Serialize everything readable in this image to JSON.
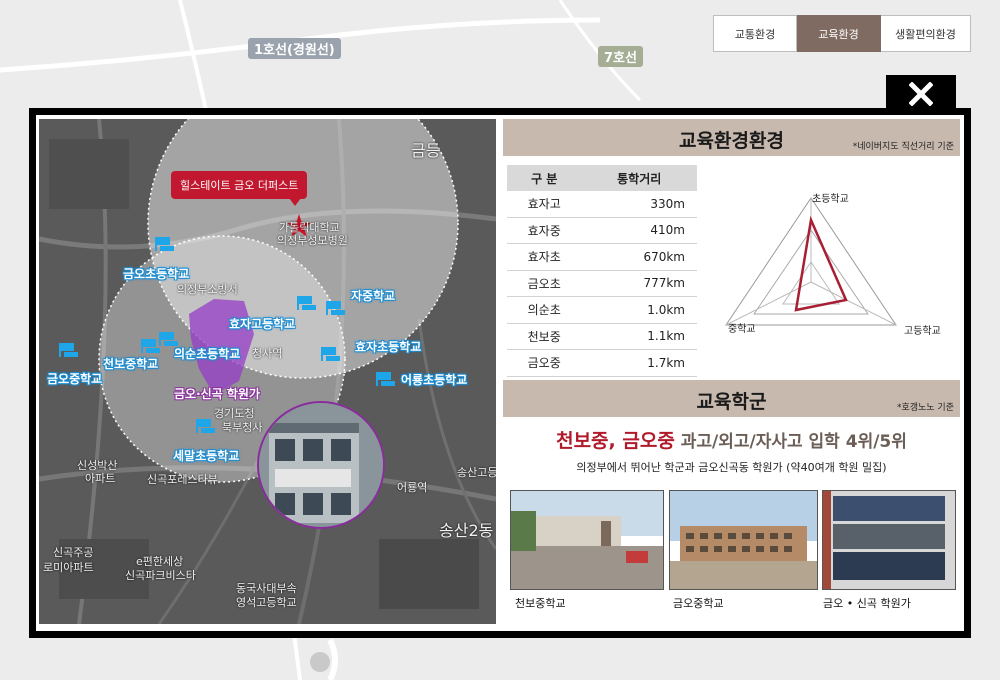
{
  "tabs": [
    {
      "label": "교통환경",
      "active": false
    },
    {
      "label": "교육환경",
      "active": true
    },
    {
      "label": "생활편의환경",
      "active": false
    }
  ],
  "background_map": {
    "labels": [
      "1호선(경원선)",
      "7호선"
    ]
  },
  "map": {
    "site_label": "힐스테이트 금오 더퍼스트",
    "area_label": "금오·신곡 학원가",
    "schools": [
      "금오초등학교",
      "자중학교",
      "효자고등학교",
      "의순초등학교",
      "천보중학교",
      "효자초등학교",
      "금오중학교",
      "어룡초등학교",
      "세말초등학교"
    ],
    "place_labels": [
      "가톨릭대학교",
      "의정부성모병원",
      "의정부소방서",
      "청사역",
      "경기도청",
      "북부청사",
      "신성박산",
      "아파트",
      "신곡포레스타뷰",
      "신곡주공",
      "로미아파트",
      "e편한세상",
      "신곡파크비스타",
      "동국사대부속",
      "영석고등학교",
      "금등",
      "송산2동",
      "어룡역",
      "송산고등"
    ]
  },
  "edu_env": {
    "title": "교육환경환경",
    "note": "*네이버지도 직선거리 기준",
    "table_headers": [
      "구 분",
      "통학거리"
    ],
    "rows": [
      {
        "name": "효자고",
        "dist": "330m"
      },
      {
        "name": "효자중",
        "dist": "410m"
      },
      {
        "name": "효자초",
        "dist": "670km"
      },
      {
        "name": "금오초",
        "dist": "777km"
      },
      {
        "name": "의순초",
        "dist": "1.0km"
      },
      {
        "name": "천보중",
        "dist": "1.1km"
      },
      {
        "name": "금오중",
        "dist": "1.7km"
      }
    ],
    "radar_labels": {
      "top": "초등학교",
      "left": "중학교",
      "right": "고등학교"
    }
  },
  "edu_zone": {
    "title": "교육학군",
    "note": "*호갱노노 기준",
    "headline_red": "천보중, 금오중",
    "headline_gray": " 과고/외고/자사고 입학 4위/5위",
    "subline": "의정부에서 뛰어난 학군과 금오신곡동 학원가 (약40여개 학원 밀집)",
    "photos": [
      {
        "caption": "천보중학교"
      },
      {
        "caption": "금오중학교"
      },
      {
        "caption": "금오 • 신곡 학원가"
      }
    ]
  },
  "colors": {
    "accent_tab": "#7f6b62",
    "head_bg": "#c8b9ae",
    "radar_line": "#a81e33",
    "headline_red": "#b11a2b"
  }
}
